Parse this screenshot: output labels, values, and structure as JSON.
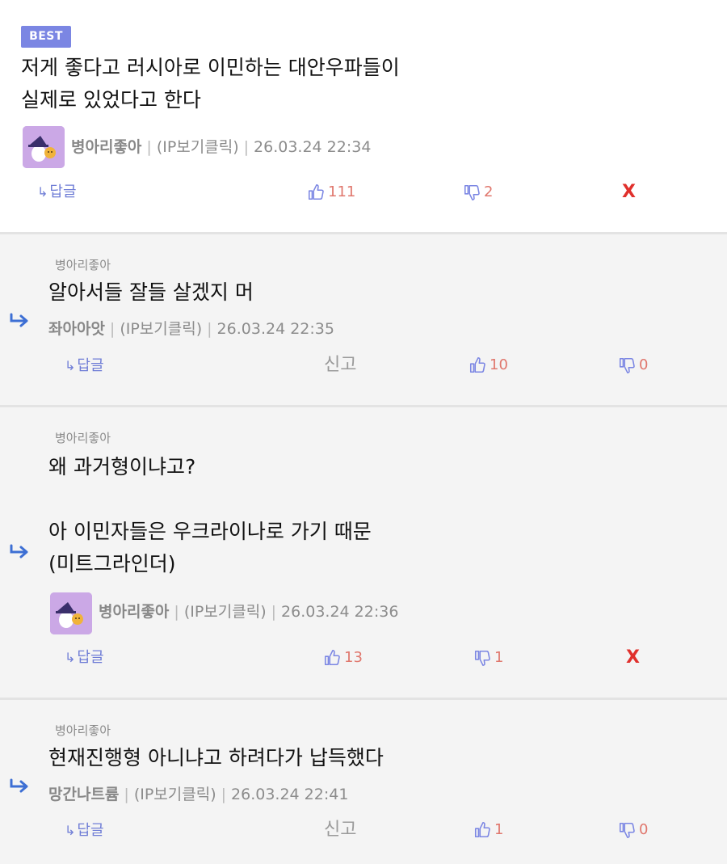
{
  "best_comment": {
    "badge": "BEST",
    "text": "저게 좋다고 러시아로 이민하는 대안우파들이\n실제로 있었다고 한다",
    "nickname": "병아리좋아",
    "ip": "(IP보기클릭)",
    "date": "26.03.24 22:34",
    "reply_label": "답글",
    "likes": "111",
    "dislikes": "2",
    "delete_label": "X"
  },
  "replies": [
    {
      "reply_to": "병아리좋아",
      "text": "알아서들 잘들 살겠지 머",
      "nickname": "좌아아앗",
      "ip": "(IP보기클릭)",
      "date": "26.03.24 22:35",
      "reply_label": "답글",
      "report_label": "신고",
      "likes": "10",
      "dislikes": "0"
    },
    {
      "reply_to": "병아리좋아",
      "text": "왜 과거형이냐고?\n\n아 이민자들은 우크라이나로 가기 때문\n(미트그라인더)",
      "nickname": "병아리좋아",
      "ip": "(IP보기클릭)",
      "date": "26.03.24 22:36",
      "reply_label": "답글",
      "likes": "13",
      "dislikes": "1",
      "delete_label": "X"
    },
    {
      "reply_to": "병아리좋아",
      "text": "현재진행형 아니냐고 하려다가 납득했다",
      "nickname": "망간나트륨",
      "ip": "(IP보기클릭)",
      "date": "26.03.24 22:41",
      "reply_label": "답글",
      "report_label": "신고",
      "likes": "1",
      "dislikes": "0"
    }
  ],
  "colors": {
    "badge": "#7b86e3",
    "reply_link": "#6f7dd6",
    "vote_icon": "#7b86e3",
    "vote_count": "#e0776d",
    "delete": "#e0302c",
    "reply_bg": "#f4f4f4"
  },
  "icons": {
    "reply_arrow": "reply-arrow-icon",
    "thumbs_up": "thumbs-up-icon",
    "thumbs_down": "thumbs-down-icon",
    "avatar": "witch-hat-chick-avatar"
  }
}
